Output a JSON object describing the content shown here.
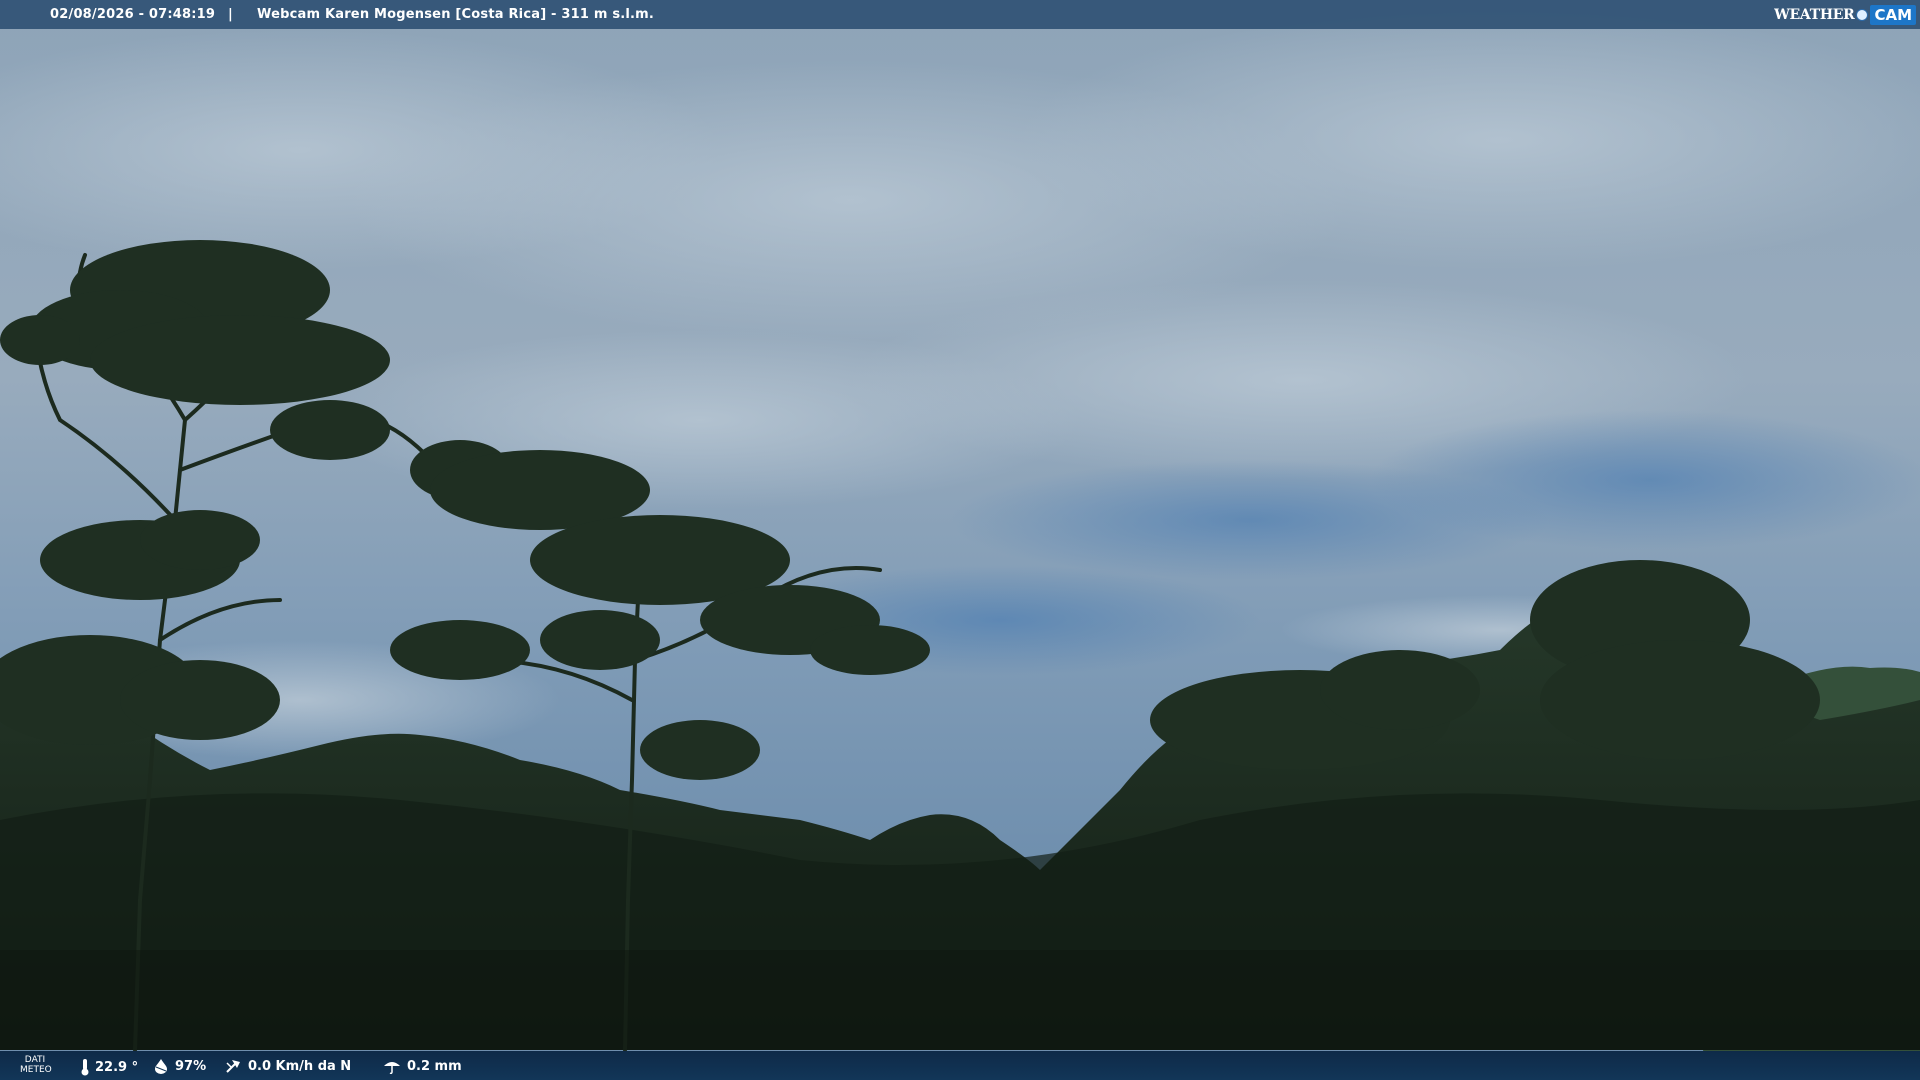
{
  "header": {
    "datetime": "02/08/2026 - 07:48:19",
    "separator": "|",
    "title": "Webcam Karen Mogensen [Costa Rica]  - 311 m s.l.m.",
    "logo_weather": "WEATHER",
    "logo_cam": "CAM"
  },
  "footer": {
    "label_line1": "DATI",
    "label_line2": "METEO",
    "temperature": "22.9 °",
    "humidity": "97%",
    "wind": "0.0 Km/h da N",
    "rain": "0.2 mm"
  },
  "icons": [
    "thermometer-icon",
    "humidity-icon",
    "wind-icon",
    "rain-icon"
  ],
  "colors": {
    "sky": "#8aa3b9",
    "forest": "#1a2a1c",
    "bar": "#123658",
    "brand": "#1d76c8"
  }
}
